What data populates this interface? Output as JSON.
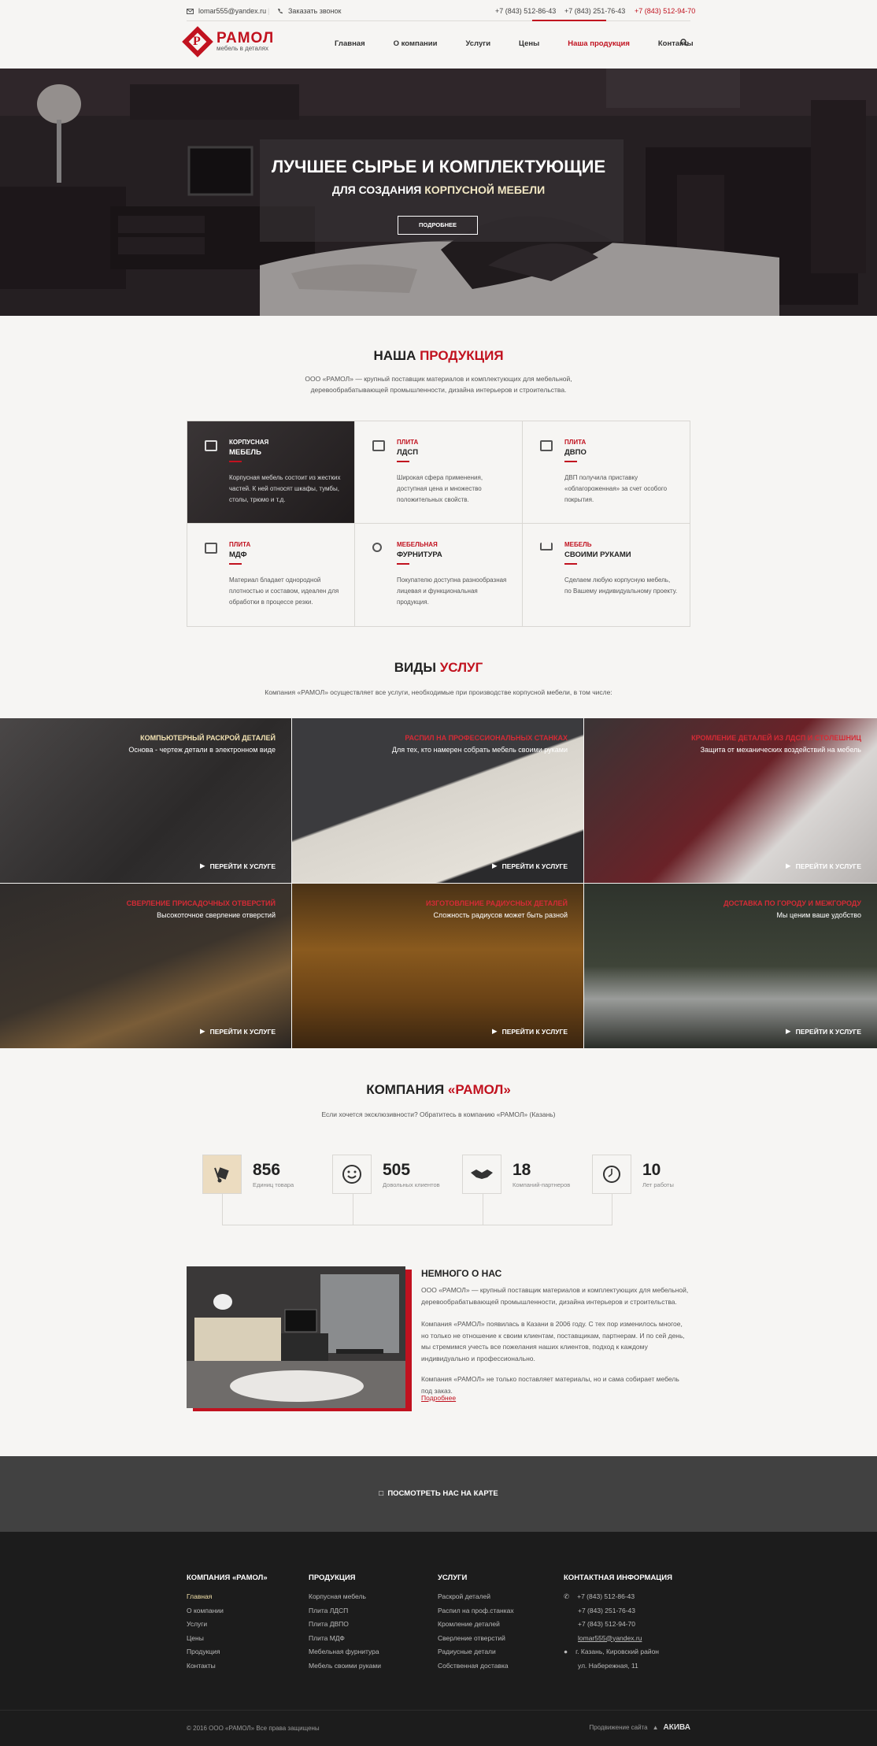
{
  "topbar": {
    "email": "lomar555@yandex.ru",
    "callback": "Заказать звонок",
    "phones": [
      "+7 (843) 512-86-43",
      "+7 (843) 251-76-43",
      "+7 (843) 512-94-70"
    ]
  },
  "header": {
    "logo_title": "РАМОЛ",
    "logo_sub": "мебель в деталях",
    "nav": [
      "Главная",
      "О компании",
      "Услуги",
      "Цены",
      "Наша продукция",
      "Контакты"
    ],
    "active_nav": "Наша продукция"
  },
  "hero": {
    "title": "ЛУЧШЕЕ СЫРЬЕ И КОМПЛЕКТУЮЩИЕ",
    "sub_a": "ДЛЯ СОЗДАНИЯ ",
    "sub_b": "КОРПУСНОЙ МЕБЕЛИ",
    "button": "ПОДРОБНЕЕ"
  },
  "products": {
    "title_a": "НАША ",
    "title_b": "ПРОДУКЦИЯ",
    "desc": "ООО «РАМОЛ» — крупный поставщик материалов и комплектующих для мебельной, деревообрабатывающей промышленности, дизайна интерьеров и строительства.",
    "items": [
      {
        "l1": "КОРПУСНАЯ",
        "l2": "МЕБЕЛЬ",
        "desc": "Корпусная мебель состоит из жестких частей. К ней относят шкафы, тумбы, столы, трюмо и т.д."
      },
      {
        "l1": "ПЛИТА",
        "l2": "ЛДСП",
        "desc": "Широкая сфера применения, доступная цена и множество положительных свойств."
      },
      {
        "l1": "ПЛИТА",
        "l2": "ДВПО",
        "desc": "ДВП получила приставку «облагороженная» за счет особого покрытия."
      },
      {
        "l1": "ПЛИТА",
        "l2": "МДФ",
        "desc": "Материал бладает однородной плотностью и составом, идеален для обработки в процессе резки."
      },
      {
        "l1": "МЕБЕЛЬНАЯ",
        "l2": "ФУРНИТУРА",
        "desc": "Покупателю доступна разнообразная лицевая и функциональная продукция."
      },
      {
        "l1": "МЕБЕЛЬ",
        "l2": "СВОИМИ РУКАМИ",
        "desc": "Сделаем любую корпусную мебель, по Вашему индивидуальному проекту."
      }
    ]
  },
  "services": {
    "title_a": "ВИДЫ ",
    "title_b": "УСЛУГ",
    "desc": "Компания «РАМОЛ» осуществляет все услуги, необходимые при производстве корпусной мебели, в том числе:",
    "go": "ПЕРЕЙТИ К УСЛУГЕ",
    "items": [
      {
        "title": "КОМПЬЮТЕРНЫЙ РАСКРОЙ ДЕТАЛЕЙ",
        "desc": "Основа - чертеж детали в электронном виде"
      },
      {
        "title": "РАСПИЛ НА ПРОФЕССИОНАЛЬНЫХ СТАНКАХ",
        "desc": "Для тех, кто намерен собрать мебель своими руками"
      },
      {
        "title": "КРОМЛЕНИЕ ДЕТАЛЕЙ ИЗ ЛДСП И СТОЛЕШНИЦ",
        "desc": "Защита от механических воздействий на мебель"
      },
      {
        "title": "СВЕРЛЕНИЕ ПРИСАДОЧНЫХ ОТВЕРСТИЙ",
        "desc": "Высокоточное сверление отверстий"
      },
      {
        "title": "ИЗГОТОВЛЕНИЕ РАДИУСНЫХ ДЕТАЛЕЙ",
        "desc": "Сложность радиусов может быть разной"
      },
      {
        "title": "ДОСТАВКА ПО ГОРОДУ И МЕЖГОРОДУ",
        "desc": "Мы ценим ваше удобство"
      }
    ]
  },
  "company": {
    "title_a": "КОМПАНИЯ ",
    "title_b": "«РАМОЛ»",
    "desc": "Если хочется эксклюзивности? Обратитесь в компанию «РАМОЛ» (Казань)",
    "stats": [
      {
        "num": "856",
        "label": "Единиц товара"
      },
      {
        "num": "505",
        "label": "Довольных клиентов"
      },
      {
        "num": "18",
        "label": "Компаний-партнеров"
      },
      {
        "num": "10",
        "label": "Лет работы"
      }
    ]
  },
  "about": {
    "title": "НЕМНОГО О НАС",
    "p1": "ООО «РАМОЛ» — крупный поставщик материалов и комплектующих для мебельной, деревообрабатывающей промышленности, дизайна интерьеров и строительства.",
    "p2": "Компания «РАМОЛ» появилась в Казани в 2006 году. С тех пор изменилось многое, но только не отношение к своим клиентам, поставщикам, партнерам. И по сей день, мы стремимся учесть все пожелания наших клиентов, подход к каждому индивидуально и профессионально.",
    "p3": "Компания «РАМОЛ» не только поставляет материалы, но и сама собирает мебель под заказ.",
    "more": "Подробнее"
  },
  "map": {
    "label": "ПОСМОТРЕТЬ НАС НА КАРТЕ"
  },
  "footer": {
    "col1": {
      "title": "КОМПАНИЯ «РАМОЛ»",
      "items": [
        "Главная",
        "О компании",
        "Услуги",
        "Цены",
        "Продукция",
        "Контакты"
      ]
    },
    "col2": {
      "title": "ПРОДУКЦИЯ",
      "items": [
        "Корпусная мебель",
        "Плита ЛДСП",
        "Плита ДВПО",
        "Плита МДФ",
        "Мебельная фурнитура",
        "Мебель своими руками"
      ]
    },
    "col3": {
      "title": "УСЛУГИ",
      "items": [
        "Раскрой деталей",
        "Распил на проф.станках",
        "Кромление деталей",
        "Сверление отверстий",
        "Радиусные детали",
        "Собственная доставка"
      ]
    },
    "col4": {
      "title": "КОНТАКТНАЯ ИНФОРМАЦИЯ",
      "phones": [
        "+7 (843) 512-86-43",
        "+7 (843) 251-76-43",
        "+7 (843) 512-94-70"
      ],
      "email": "lomar555@yandex.ru",
      "addr1": "г. Казань, Кировский район",
      "addr2": "ул. Набережная, 11"
    },
    "copyright": "© 2016 ООО «РАМОЛ» Все права защищены",
    "promo": "Продвижение сайта",
    "promo_brand": "АКИВА"
  },
  "colors": {
    "accent": "#c1121f",
    "dark": "#1c1c1c",
    "bg": "#f6f5f3"
  }
}
